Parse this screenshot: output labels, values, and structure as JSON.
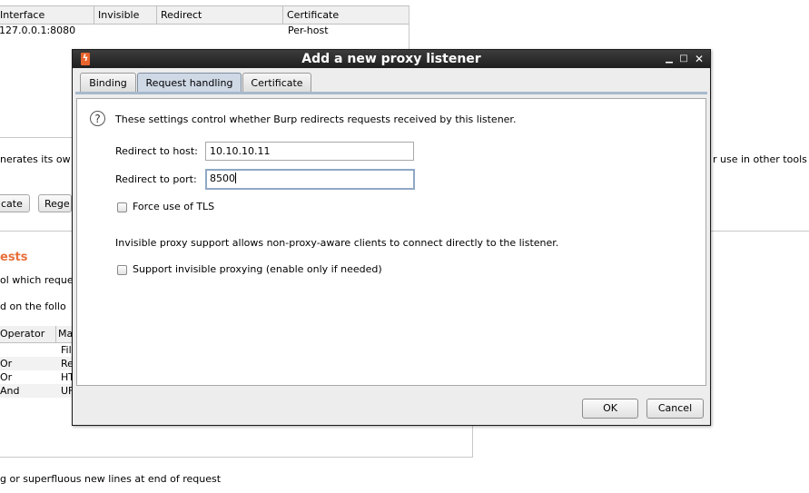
{
  "background": {
    "listeners_table": {
      "headers": [
        "Interface",
        "Invisible",
        "Redirect",
        "Certificate"
      ],
      "rows": [
        {
          "interface": "127.0.0.1:8080",
          "invisible": "",
          "redirect": "",
          "certificate": "Per-host"
        }
      ]
    },
    "cert_text_left": "nerates its ow",
    "cert_text_right": "r use in other tools",
    "buttons": [
      "cate",
      "Rege"
    ],
    "section_title": "ests",
    "desc_line1": "ol which reque",
    "desc_line2": "d on the follo",
    "rules_table": {
      "headers": [
        "Operator",
        "Ma"
      ],
      "rows": [
        {
          "operator": "",
          "match": "Fil"
        },
        {
          "operator": "Or",
          "match": "Re"
        },
        {
          "operator": "Or",
          "match": "HT"
        },
        {
          "operator": "And",
          "match": "UF"
        }
      ]
    },
    "footer_text": "g or superfluous new lines at end of request"
  },
  "dialog": {
    "title": "Add a new proxy listener",
    "app_icon": "burp-icon",
    "window_controls": [
      "minimize",
      "maximize",
      "close"
    ],
    "tabs": [
      {
        "label": "Binding",
        "active": false
      },
      {
        "label": "Request handling",
        "active": true
      },
      {
        "label": "Certificate",
        "active": false
      }
    ],
    "intro": "These settings control whether Burp redirects requests received by this listener.",
    "redirect_host": {
      "label": "Redirect to host:",
      "value": "10.10.10.11"
    },
    "redirect_port": {
      "label": "Redirect to port:",
      "value": "8500"
    },
    "force_tls": {
      "label": "Force use of TLS",
      "checked": false
    },
    "invisible_info": "Invisible proxy support allows non-proxy-aware clients to connect directly to the listener.",
    "invisible_support": {
      "label": "Support invisible proxying (enable only if needed)",
      "checked": false
    },
    "ok_label": "OK",
    "cancel_label": "Cancel"
  },
  "colors": {
    "accent_orange": "#e8703a",
    "titlebar": "#2a2a2a",
    "active_tab": "#cfd9e6",
    "focus_ring": "#8fa8c4"
  }
}
